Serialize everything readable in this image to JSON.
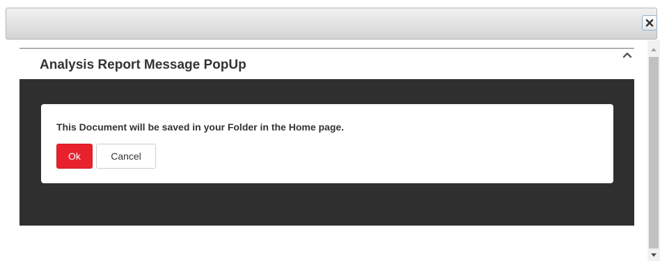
{
  "dialog": {
    "title": "Analysis Report Message PopUp",
    "message": "This Document will be saved in your Folder in the Home page.",
    "ok_label": "Ok",
    "cancel_label": "Cancel"
  },
  "icons": {
    "close": "close-icon",
    "collapse": "chevron-up-icon",
    "scroll_up": "scroll-up-arrow-icon",
    "scroll_down": "scroll-down-arrow-icon"
  },
  "colors": {
    "ok_button": "#e8212f",
    "panel_background": "#2f2f2f",
    "title_text": "#333333"
  }
}
